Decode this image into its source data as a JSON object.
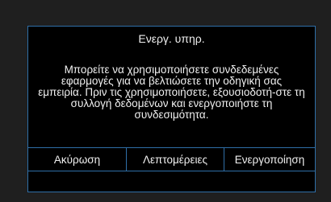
{
  "dialog": {
    "title": "Ενεργ. υπηρ.",
    "message": "Μπορείτε να χρησιμοποιήσετε συνδεδεμένες εφαρμογές για να βελτιώσετε την οδηγική σας εμπειρία. Πριν τις χρησιμοποιήσετε, εξουσιοδοτή-στε τη συλλογή δεδομένων και ενεργοποιήστε τη συνδεσιμότητα.",
    "buttons": {
      "cancel": "Ακύρωση",
      "details": "Λεπτομέρειες",
      "activate": "Ενεργοποίηση"
    }
  },
  "colors": {
    "background": "#1f1f1f",
    "dialog_background": "#000000",
    "border": "#2f6fa8",
    "text": "#f0f0f0"
  }
}
